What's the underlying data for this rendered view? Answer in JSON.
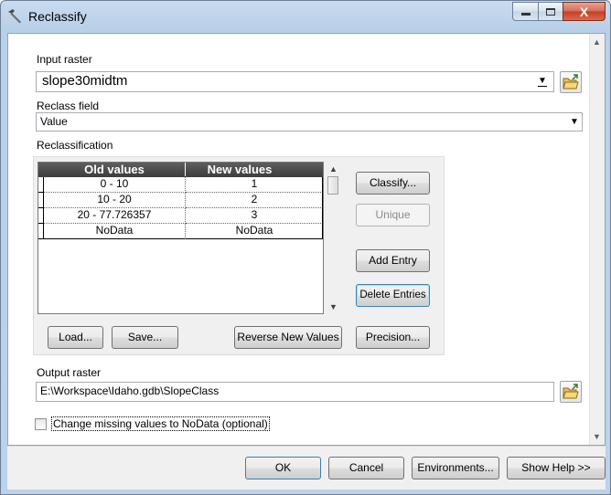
{
  "window": {
    "title": "Reclassify",
    "controls": {
      "minimize": "–",
      "maximize": "□",
      "close": "X"
    }
  },
  "input_raster": {
    "label": "Input raster",
    "value": "slope30midtm"
  },
  "reclass_field": {
    "label": "Reclass field",
    "value": "Value"
  },
  "reclassification": {
    "label": "Reclassification",
    "columns": [
      "Old values",
      "New values"
    ],
    "rows": [
      {
        "old": "0 - 10",
        "new": "1"
      },
      {
        "old": "10 - 20",
        "new": "2"
      },
      {
        "old": "20 - 77.726357",
        "new": "3"
      },
      {
        "old": "NoData",
        "new": "NoData"
      }
    ],
    "buttons": {
      "classify": "Classify...",
      "unique": "Unique",
      "add_entry": "Add Entry",
      "delete_entries": "Delete Entries",
      "load": "Load...",
      "save": "Save...",
      "reverse": "Reverse New Values",
      "precision": "Precision..."
    }
  },
  "output_raster": {
    "label": "Output raster",
    "value": "E:\\Workspace\\Idaho.gdb\\SlopeClass"
  },
  "missing_nodata": {
    "label": "Change missing values to NoData (optional)",
    "checked": false
  },
  "footer": {
    "ok": "OK",
    "cancel": "Cancel",
    "environments": "Environments...",
    "show_help": "Show Help >>"
  },
  "icons": {
    "title": "hammer-icon",
    "browse": "open-folder-icon"
  }
}
